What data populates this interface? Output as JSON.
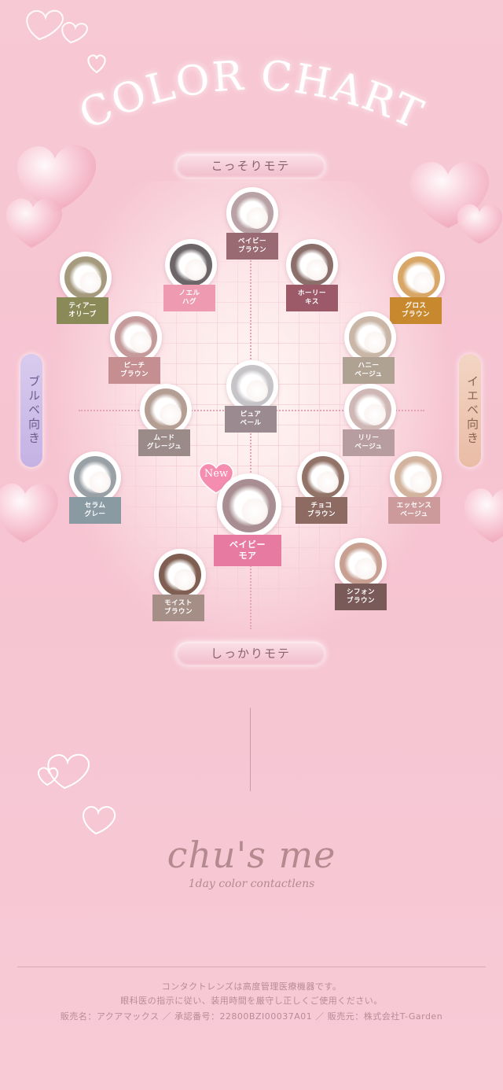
{
  "title": "COLOR CHART",
  "axis": {
    "top": "こっそりモテ",
    "bottom": "しっかりモテ",
    "left": "ブルベ向き",
    "right": "イエベ向き"
  },
  "new_badge": "New",
  "lenses": [
    {
      "line1": "ベイビー",
      "line2": "ブラウン",
      "tag_color": "#9a6a72",
      "ring_color": "#b9a2a6"
    },
    {
      "line1": "ノエル",
      "line2": "ハグ",
      "tag_color": "#ee9bb2",
      "ring_color": "#6d6668"
    },
    {
      "line1": "ホーリー",
      "line2": "キス",
      "tag_color": "#9c5a68",
      "ring_color": "#8a6f6b"
    },
    {
      "line1": "ティアー",
      "line2": "オリーブ",
      "tag_color": "#8a8a58",
      "ring_color": "#a59a7e"
    },
    {
      "line1": "グロス",
      "line2": "ブラウン",
      "tag_color": "#c8882e",
      "ring_color": "#d8a768"
    },
    {
      "line1": "ピーチ",
      "line2": "ブラウン",
      "tag_color": "#c58e90",
      "ring_color": "#c49a9a"
    },
    {
      "line1": "ハニー",
      "line2": "ベージュ",
      "tag_color": "#b0a293",
      "ring_color": "#c9b6a6"
    },
    {
      "line1": "ピュア",
      "line2": "ベール",
      "tag_color": "#9b8b91",
      "ring_color": "#c7c4c8"
    },
    {
      "line1": "ムード",
      "line2": "グレージュ",
      "tag_color": "#9a8a88",
      "ring_color": "#b49d92"
    },
    {
      "line1": "リリー",
      "line2": "ベージュ",
      "tag_color": "#b79ca0",
      "ring_color": "#cfb7b5"
    },
    {
      "line1": "セラム",
      "line2": "グレー",
      "tag_color": "#8a9aa3",
      "ring_color": "#9aa1a6"
    },
    {
      "line1": "チョコ",
      "line2": "ブラウン",
      "tag_color": "#8d6a62",
      "ring_color": "#927368"
    },
    {
      "line1": "エッセンス",
      "line2": "ベージュ",
      "tag_color": "#cc9a9a",
      "ring_color": "#d2b39d"
    },
    {
      "line1": "ベイビー",
      "line2": "モア",
      "tag_color": "#e77aa1",
      "ring_color": "#a88e92"
    },
    {
      "line1": "モイスト",
      "line2": "ブラウン",
      "tag_color": "#a58e86",
      "ring_color": "#7e5f52"
    },
    {
      "line1": "シフォン",
      "line2": "ブラウン",
      "tag_color": "#7a5a58",
      "ring_color": "#c8a091"
    }
  ],
  "brand": {
    "logo": "chu's me",
    "tagline": "1day color contactlens"
  },
  "footer": {
    "line1": "コンタクトレンズは高度管理医療機器です。",
    "line2": "眼科医の指示に従い、装用時間を厳守し正しくご使用ください。",
    "line3": "販売名：アクアマックス ／ 承認番号：22800BZI00037A01 ／ 販売元：株式会社T-Garden"
  },
  "icons": {
    "hearts": "heart-icon"
  }
}
